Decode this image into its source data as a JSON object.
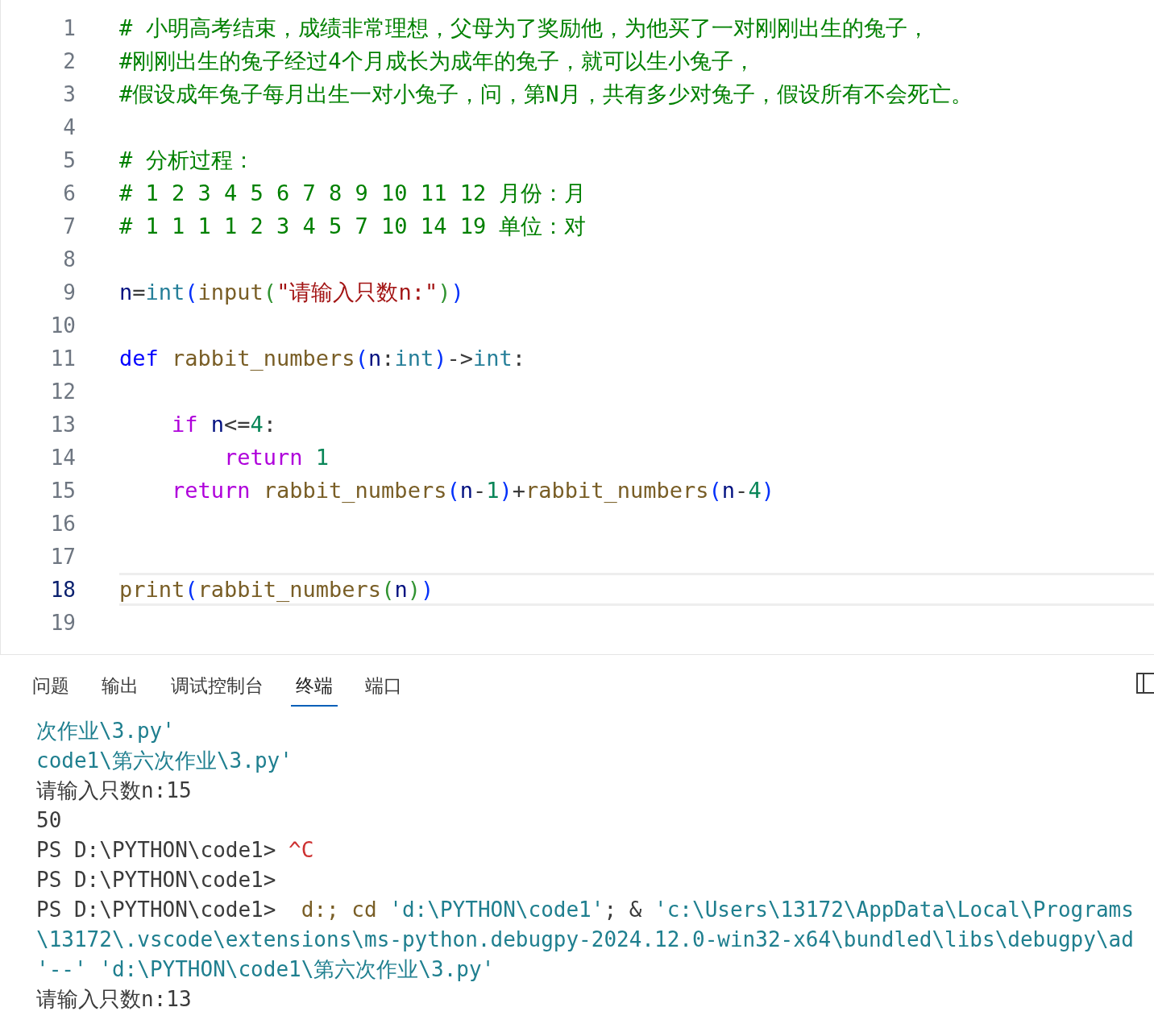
{
  "editor": {
    "lines": [
      {
        "number": "1",
        "current": false,
        "tokens": [
          {
            "kind": "comment",
            "text": "# 小明高考结束，成绩非常理想，父母为了奖励他，为他买了一对刚刚出生的兔子，"
          }
        ]
      },
      {
        "number": "2",
        "current": false,
        "tokens": [
          {
            "kind": "comment",
            "text": "#刚刚出生的兔子经过4个月成长为成年的兔子，就可以生小兔子，"
          }
        ]
      },
      {
        "number": "3",
        "current": false,
        "tokens": [
          {
            "kind": "comment",
            "text": "#假设成年兔子每月出生一对小兔子，问，第N月，共有多少对兔子，假设所有不会死亡。"
          }
        ]
      },
      {
        "number": "4",
        "current": false
      },
      {
        "number": "5",
        "current": false,
        "tokens": [
          {
            "kind": "comment",
            "text": "# 分析过程："
          }
        ]
      },
      {
        "number": "6",
        "current": false,
        "tokens": [
          {
            "kind": "comment",
            "text": "# 1 2 3 4 5 6 7 8 9 10 11 12 月份：月"
          }
        ]
      },
      {
        "number": "7",
        "current": false,
        "tokens": [
          {
            "kind": "comment",
            "text": "# 1 1 1 1 2 3 4 5 7 10 14 19 单位：对"
          }
        ]
      },
      {
        "number": "8",
        "current": false
      },
      {
        "number": "9",
        "current": false,
        "tokens": [
          {
            "kind": "variable",
            "text": "n"
          },
          {
            "kind": "plain",
            "text": "="
          },
          {
            "kind": "type",
            "text": "int"
          },
          {
            "kind": "paren",
            "text": "("
          },
          {
            "kind": "function",
            "text": "input"
          },
          {
            "kind": "paren2",
            "text": "("
          },
          {
            "kind": "string",
            "text": "\"请输入只数n:\""
          },
          {
            "kind": "paren2",
            "text": ")"
          },
          {
            "kind": "paren",
            "text": ")"
          }
        ]
      },
      {
        "number": "10",
        "current": false
      },
      {
        "number": "11",
        "current": false,
        "tokens": [
          {
            "kind": "keyword",
            "text": "def"
          },
          {
            "kind": "function",
            "text": " rabbit_numbers"
          },
          {
            "kind": "paren",
            "text": "("
          },
          {
            "kind": "variable",
            "text": "n"
          },
          {
            "kind": "plain",
            "text": ":"
          },
          {
            "kind": "type",
            "text": "int"
          },
          {
            "kind": "paren",
            "text": ")"
          },
          {
            "kind": "plain",
            "text": "->"
          },
          {
            "kind": "type",
            "text": "int"
          },
          {
            "kind": "plain",
            "text": ":"
          }
        ]
      },
      {
        "number": "12",
        "current": false
      },
      {
        "number": "13",
        "current": false,
        "tokens": [
          {
            "kind": "control",
            "text": "    if"
          },
          {
            "kind": "variable",
            "text": " n"
          },
          {
            "kind": "plain",
            "text": "<="
          },
          {
            "kind": "number",
            "text": "4"
          },
          {
            "kind": "plain",
            "text": ":"
          }
        ]
      },
      {
        "number": "14",
        "current": false,
        "tokens": [
          {
            "kind": "control",
            "text": "        return"
          },
          {
            "kind": "number",
            "text": " 1"
          }
        ]
      },
      {
        "number": "15",
        "current": false,
        "tokens": [
          {
            "kind": "control",
            "text": "    return"
          },
          {
            "kind": "function",
            "text": " rabbit_numbers"
          },
          {
            "kind": "paren",
            "text": "("
          },
          {
            "kind": "variable",
            "text": "n"
          },
          {
            "kind": "plain",
            "text": "-"
          },
          {
            "kind": "number",
            "text": "1"
          },
          {
            "kind": "paren",
            "text": ")"
          },
          {
            "kind": "plain",
            "text": "+"
          },
          {
            "kind": "function",
            "text": "rabbit_numbers"
          },
          {
            "kind": "paren",
            "text": "("
          },
          {
            "kind": "variable",
            "text": "n"
          },
          {
            "kind": "plain",
            "text": "-"
          },
          {
            "kind": "number",
            "text": "4"
          },
          {
            "kind": "paren",
            "text": ")"
          }
        ]
      },
      {
        "number": "16",
        "current": false
      },
      {
        "number": "17",
        "current": false
      },
      {
        "number": "18",
        "current": true,
        "tokens": [
          {
            "kind": "function",
            "text": "print"
          },
          {
            "kind": "paren",
            "text": "("
          },
          {
            "kind": "function",
            "text": "rabbit_numbers"
          },
          {
            "kind": "paren2",
            "text": "("
          },
          {
            "kind": "variable",
            "text": "n"
          },
          {
            "kind": "paren2",
            "text": ")"
          },
          {
            "kind": "paren",
            "text": ")"
          }
        ]
      },
      {
        "number": "19",
        "current": false
      }
    ]
  },
  "panel": {
    "tabs": [
      {
        "label": "问题",
        "selected": false
      },
      {
        "label": "输出",
        "selected": false
      },
      {
        "label": "调试控制台",
        "selected": false
      },
      {
        "label": "终端",
        "selected": true
      },
      {
        "label": "端口",
        "selected": false
      }
    ],
    "terminal": [
      [
        {
          "kind": "path",
          "text": "次作业\\3.py'"
        }
      ],
      [
        {
          "kind": "path",
          "text": "code1\\第六次作业\\3.py'"
        }
      ],
      [
        {
          "kind": "plain",
          "text": "请输入只数n:15"
        }
      ],
      [
        {
          "kind": "plain",
          "text": "50"
        }
      ],
      [
        {
          "kind": "plain",
          "text": "PS D:\\PYTHON\\code1> "
        },
        {
          "kind": "error",
          "text": "^C"
        }
      ],
      [
        {
          "kind": "plain",
          "text": "PS D:\\PYTHON\\code1>"
        }
      ],
      [
        {
          "kind": "plain",
          "text": "PS D:\\PYTHON\\code1>  "
        },
        {
          "kind": "command",
          "text": "d:; cd"
        },
        {
          "kind": "path",
          "text": " 'd:\\PYTHON\\code1'"
        },
        {
          "kind": "plain",
          "text": "; & "
        },
        {
          "kind": "path",
          "text": "'c:\\Users\\13172\\AppData\\Local\\Programs"
        }
      ],
      [
        {
          "kind": "path",
          "text": "\\13172\\.vscode\\extensions\\ms-python.debugpy-2024.12.0-win32-x64\\bundled\\libs\\debugpy\\ad"
        }
      ],
      [
        {
          "kind": "path",
          "text": "'--' 'd:\\PYTHON\\code1\\第六次作业\\3.py'"
        }
      ],
      [
        {
          "kind": "plain",
          "text": "请输入只数n:13"
        }
      ]
    ]
  }
}
